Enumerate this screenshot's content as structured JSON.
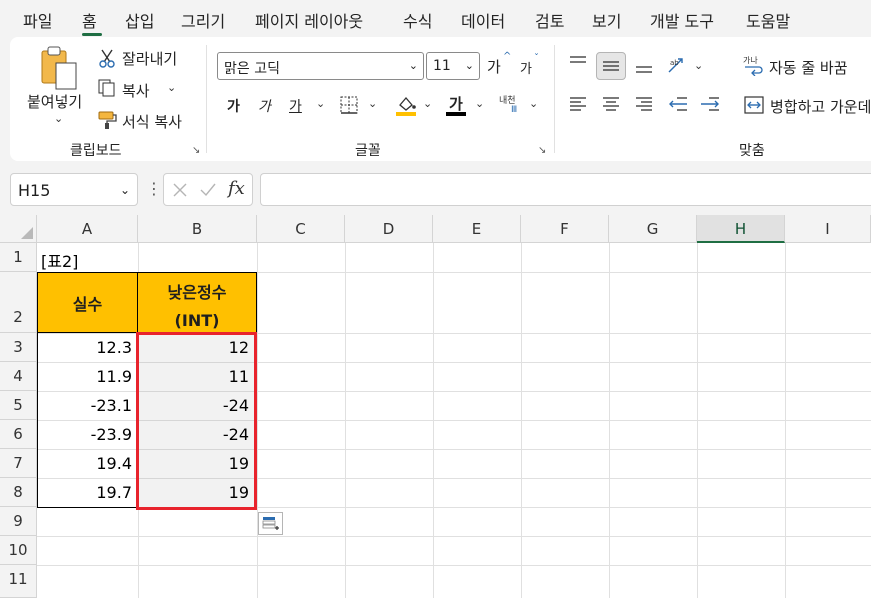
{
  "menu": {
    "tabs": [
      "파일",
      "홈",
      "삽입",
      "그리기",
      "페이지 레이아웃",
      "수식",
      "데이터",
      "검토",
      "보기",
      "개발 도구",
      "도움말"
    ],
    "active_tab": "홈"
  },
  "ribbon": {
    "clipboard": {
      "paste_label": "붙여넣기",
      "cut_label": "잘라내기",
      "copy_label": "복사",
      "format_painter_label": "서식 복사",
      "group_label": "클립보드"
    },
    "font": {
      "font_name": "맑은 고딕",
      "font_size": "11",
      "grow_label": "가",
      "shrink_label": "가",
      "bold_label": "가",
      "italic_label": "가",
      "underline_label": "가",
      "font_color_label": "가",
      "phonetic_label": "내천",
      "group_label": "글꼴"
    },
    "alignment": {
      "orientation_icon": "orientation-icon",
      "wrap_label": "자동 줄 바꿈",
      "merge_label": "병합하고 가운데",
      "group_label": "맞춤"
    }
  },
  "formula_bar": {
    "name_box": "H15",
    "formula": ""
  },
  "sheet": {
    "columns": [
      "A",
      "B",
      "C",
      "D",
      "E",
      "F",
      "G",
      "H",
      "I"
    ],
    "selected_column": "H",
    "rows": [
      "1",
      "2",
      "3",
      "4",
      "5",
      "6",
      "7",
      "8",
      "9",
      "10",
      "11"
    ],
    "a1": "[표2]",
    "header_real": "실수",
    "header_int_line1": "낮은정수",
    "header_int_line2": "(INT)",
    "data": [
      {
        "real": "12.3",
        "int": "12"
      },
      {
        "real": "11.9",
        "int": "11"
      },
      {
        "real": "-23.1",
        "int": "-24"
      },
      {
        "real": "-23.9",
        "int": "-24"
      },
      {
        "real": "19.4",
        "int": "19"
      },
      {
        "real": "19.7",
        "int": "19"
      }
    ],
    "header_fill": "#ffc000",
    "result_fill": "#f2f2f2",
    "highlight_border": "#e8232c"
  }
}
